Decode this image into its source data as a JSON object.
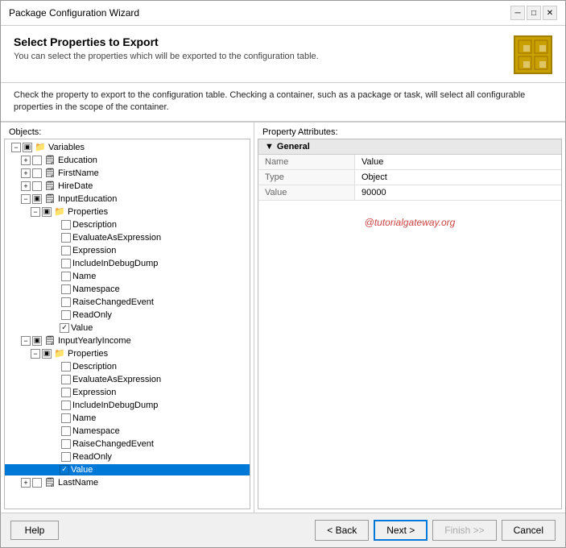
{
  "window": {
    "title": "Package Configuration Wizard",
    "title_controls": [
      "minimize",
      "maximize",
      "close"
    ]
  },
  "header": {
    "title": "Select Properties to Export",
    "subtitle": "You can select the properties which will be exported to the configuration table."
  },
  "description": "Check the property to export to the configuration table. Checking a container, such as a package or task, will select all configurable properties in the scope of the container.",
  "left_panel": {
    "label": "Objects:",
    "tree": [
      {
        "id": "variables",
        "label": "Variables",
        "indent": 0,
        "expanded": true,
        "hasExpander": true,
        "checked": "partial",
        "icon": "folder"
      },
      {
        "id": "education",
        "label": "Education",
        "indent": 1,
        "expanded": false,
        "hasExpander": true,
        "checked": "unchecked",
        "icon": "item"
      },
      {
        "id": "firstname",
        "label": "FirstName",
        "indent": 1,
        "expanded": false,
        "hasExpander": true,
        "checked": "unchecked",
        "icon": "item"
      },
      {
        "id": "hiredate",
        "label": "HireDate",
        "indent": 1,
        "expanded": false,
        "hasExpander": true,
        "checked": "unchecked",
        "icon": "item"
      },
      {
        "id": "inputeducation",
        "label": "InputEducation",
        "indent": 1,
        "expanded": true,
        "hasExpander": true,
        "checked": "partial",
        "icon": "item"
      },
      {
        "id": "properties1",
        "label": "Properties",
        "indent": 2,
        "expanded": true,
        "hasExpander": true,
        "checked": "partial",
        "icon": "folder"
      },
      {
        "id": "description1",
        "label": "Description",
        "indent": 3,
        "hasExpander": false,
        "checked": "unchecked",
        "icon": "none"
      },
      {
        "id": "evaluateasexpression1",
        "label": "EvaluateAsExpression",
        "indent": 3,
        "hasExpander": false,
        "checked": "unchecked",
        "icon": "none"
      },
      {
        "id": "expression1",
        "label": "Expression",
        "indent": 3,
        "hasExpander": false,
        "checked": "unchecked",
        "icon": "none"
      },
      {
        "id": "includeindebugdump1",
        "label": "IncludeInDebugDump",
        "indent": 3,
        "hasExpander": false,
        "checked": "unchecked",
        "icon": "none"
      },
      {
        "id": "name1",
        "label": "Name",
        "indent": 3,
        "hasExpander": false,
        "checked": "unchecked",
        "icon": "none"
      },
      {
        "id": "namespace1",
        "label": "Namespace",
        "indent": 3,
        "hasExpander": false,
        "checked": "unchecked",
        "icon": "none"
      },
      {
        "id": "raisechangedevent1",
        "label": "RaiseChangedEvent",
        "indent": 3,
        "hasExpander": false,
        "checked": "unchecked",
        "icon": "none"
      },
      {
        "id": "readonly1",
        "label": "ReadOnly",
        "indent": 3,
        "hasExpander": false,
        "checked": "unchecked",
        "icon": "none"
      },
      {
        "id": "value1",
        "label": "Value",
        "indent": 3,
        "hasExpander": false,
        "checked": "checked",
        "icon": "none",
        "hasArrow": true
      },
      {
        "id": "inputyearlyincome",
        "label": "InputYearlyIncome",
        "indent": 1,
        "expanded": true,
        "hasExpander": true,
        "checked": "partial",
        "icon": "item"
      },
      {
        "id": "properties2",
        "label": "Properties",
        "indent": 2,
        "expanded": true,
        "hasExpander": true,
        "checked": "partial",
        "icon": "folder"
      },
      {
        "id": "description2",
        "label": "Description",
        "indent": 3,
        "hasExpander": false,
        "checked": "unchecked",
        "icon": "none"
      },
      {
        "id": "evaluateasexpression2",
        "label": "EvaluateAsExpression",
        "indent": 3,
        "hasExpander": false,
        "checked": "unchecked",
        "icon": "none"
      },
      {
        "id": "expression2",
        "label": "Expression",
        "indent": 3,
        "hasExpander": false,
        "checked": "unchecked",
        "icon": "none"
      },
      {
        "id": "includeindebugdump2",
        "label": "IncludeInDebugDump",
        "indent": 3,
        "hasExpander": false,
        "checked": "unchecked",
        "icon": "none"
      },
      {
        "id": "name2",
        "label": "Name",
        "indent": 3,
        "hasExpander": false,
        "checked": "unchecked",
        "icon": "none"
      },
      {
        "id": "namespace2",
        "label": "Namespace",
        "indent": 3,
        "hasExpander": false,
        "checked": "unchecked",
        "icon": "none"
      },
      {
        "id": "raisechangedevent2",
        "label": "RaiseChangedEvent",
        "indent": 3,
        "hasExpander": false,
        "checked": "unchecked",
        "icon": "none"
      },
      {
        "id": "readonly2",
        "label": "ReadOnly",
        "indent": 3,
        "hasExpander": false,
        "checked": "unchecked",
        "icon": "none"
      },
      {
        "id": "value2",
        "label": "Value",
        "indent": 3,
        "hasExpander": false,
        "checked": "checked",
        "icon": "none",
        "hasArrow": true,
        "selected": true
      },
      {
        "id": "lastname",
        "label": "LastName",
        "indent": 1,
        "expanded": false,
        "hasExpander": true,
        "checked": "unchecked",
        "icon": "item"
      }
    ]
  },
  "right_panel": {
    "label": "Property Attributes:",
    "section_label": "General",
    "rows": [
      {
        "key": "Name",
        "value": "Value"
      },
      {
        "key": "Type",
        "value": "Object"
      },
      {
        "key": "Value",
        "value": "90000"
      }
    ],
    "watermark": "@tutorialgateway.org"
  },
  "footer": {
    "help_label": "Help",
    "back_label": "< Back",
    "next_label": "Next >",
    "finish_label": "Finish >>",
    "cancel_label": "Cancel"
  }
}
